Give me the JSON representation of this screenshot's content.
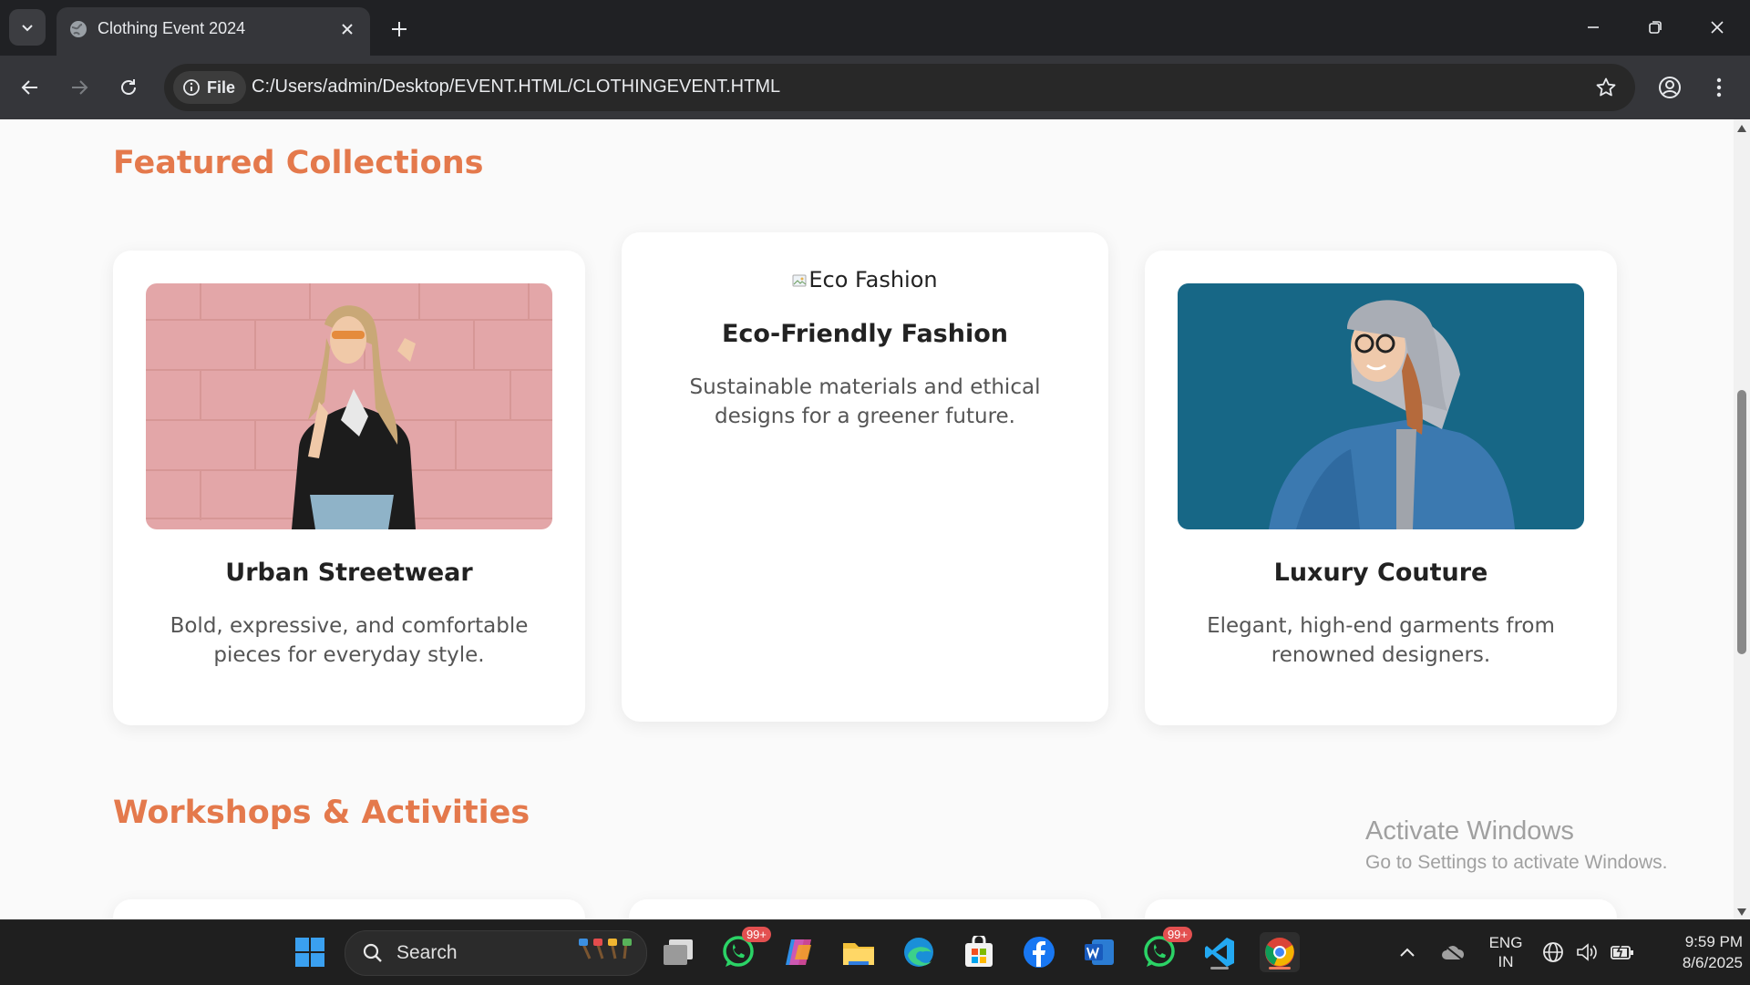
{
  "browser": {
    "tab_title": "Clothing Event 2024",
    "file_chip_label": "File",
    "url": "C:/Users/admin/Desktop/EVENT.HTML/CLOTHINGEVENT.HTML"
  },
  "page": {
    "featured_title": "Featured Collections",
    "cards": [
      {
        "title": "Urban Streetwear",
        "description": "Bold, expressive, and comfortable pieces for everyday style.",
        "image": "photo-pink-wall"
      },
      {
        "image_alt": "Eco Fashion",
        "title": "Eco-Friendly Fashion",
        "description": "Sustainable materials and ethical designs for a greener future."
      },
      {
        "title": "Luxury Couture",
        "description": "Elegant, high-end garments from renowned designers.",
        "image": "photo-blue-wall"
      }
    ],
    "workshops_title": "Workshops & Activities"
  },
  "watermark": {
    "line1": "Activate Windows",
    "line2": "Go to Settings to activate Windows."
  },
  "taskbar": {
    "search_label": "Search",
    "whatsapp_badge": "99+",
    "whatsapp2_badge": "99+",
    "lang_line1": "ENG",
    "lang_line2": "IN",
    "time": "9:59 PM",
    "date": "8/6/2025"
  },
  "colors": {
    "accent": "#e4794c",
    "tabbar": "#202124",
    "toolbar": "#35363a"
  }
}
